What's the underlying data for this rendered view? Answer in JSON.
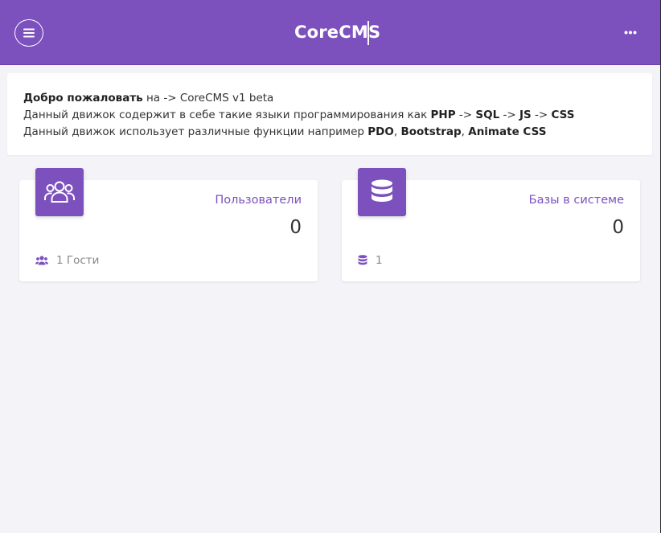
{
  "header": {
    "brand": "CoreCMS",
    "menu_icon": "hamburger-menu-icon",
    "more_icon": "more-horizontal-icon",
    "accent": "#7c51bd"
  },
  "welcome": {
    "line1": {
      "bold": "Добро пожаловать",
      "rest": " на -> CoreCMS v1 beta"
    },
    "line2": {
      "prefix": "Данный движок содержит в себе такие языки программирования как ",
      "lang1": "PHP",
      "sep1": " -> ",
      "lang2": "SQL",
      "sep2": " -> ",
      "lang3": "JS",
      "sep3": " -> ",
      "lang4": "CSS"
    },
    "line3": {
      "prefix": "Данный движок использует различные функции например ",
      "f1": "PDO",
      "sep1": ", ",
      "f2": "Bootstrap",
      "sep2": ", ",
      "f3": "Animate CSS"
    }
  },
  "cards": [
    {
      "title": "Пользователи",
      "value": "0",
      "footer": "1 Гости",
      "icon": "users-icon",
      "footer_icon": "users-icon"
    },
    {
      "title": "Базы в системе",
      "value": "0",
      "footer": "1",
      "icon": "database-icon",
      "footer_icon": "database-icon"
    }
  ]
}
